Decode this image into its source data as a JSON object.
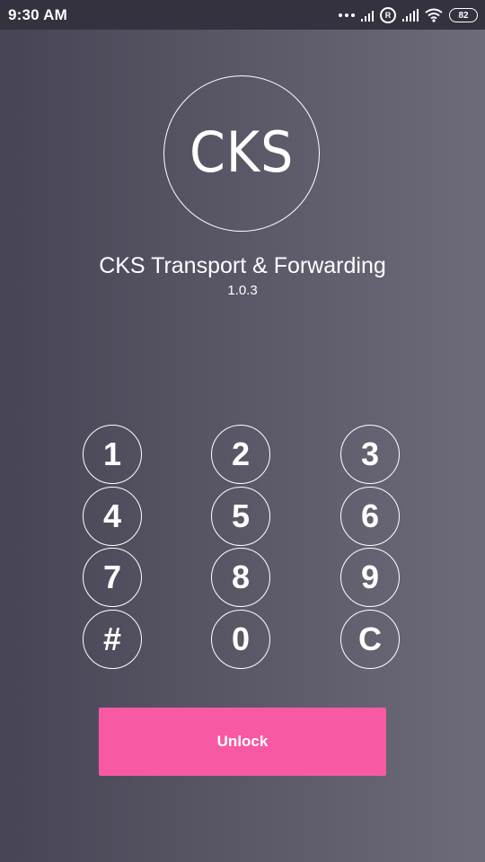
{
  "status_bar": {
    "time": "9:30 AM",
    "roaming_badge": "R",
    "battery_level": "82",
    "icons": [
      "more-dots-icon",
      "signal-icon",
      "roaming-icon",
      "signal-icon",
      "wifi-icon",
      "battery-icon"
    ]
  },
  "app": {
    "logo_text": "CKS",
    "title": "CKS Transport & Forwarding",
    "version": "1.0.3"
  },
  "keypad": {
    "keys": [
      "1",
      "2",
      "3",
      "4",
      "5",
      "6",
      "7",
      "8",
      "9",
      "#",
      "0",
      "C"
    ]
  },
  "actions": {
    "unlock_label": "Unlock"
  },
  "colors": {
    "accent": "#f75aa3",
    "status_bar": "#34323f",
    "background_start": "#474555",
    "background_end": "#6d6b7a"
  }
}
